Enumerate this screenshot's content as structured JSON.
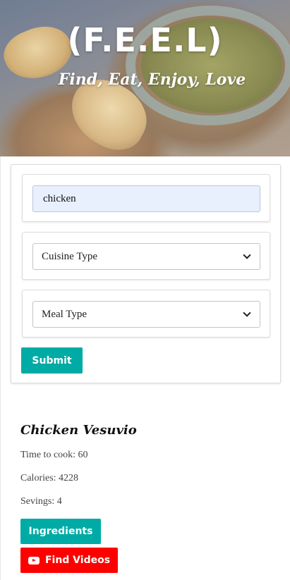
{
  "hero": {
    "title": "(F.E.E.L)",
    "tagline": "Find, Eat, Enjoy, Love"
  },
  "search": {
    "query_value": "chicken",
    "cuisine_select": "Cuisine Type",
    "meal_select": "Meal Type",
    "submit_label": "Submit"
  },
  "result": {
    "title": "Chicken Vesuvio",
    "time_to_cook": "Time to cook: 60",
    "calories": "Calories: 4228",
    "servings": "Sevings: 4",
    "ingredients_label": "Ingredients",
    "videos_label": "Find Videos",
    "videos_icon": "youtube-icon"
  },
  "colors": {
    "accent": "#00aba5",
    "video_button": "#ff0000",
    "input_fill": "#e8f0fe"
  }
}
